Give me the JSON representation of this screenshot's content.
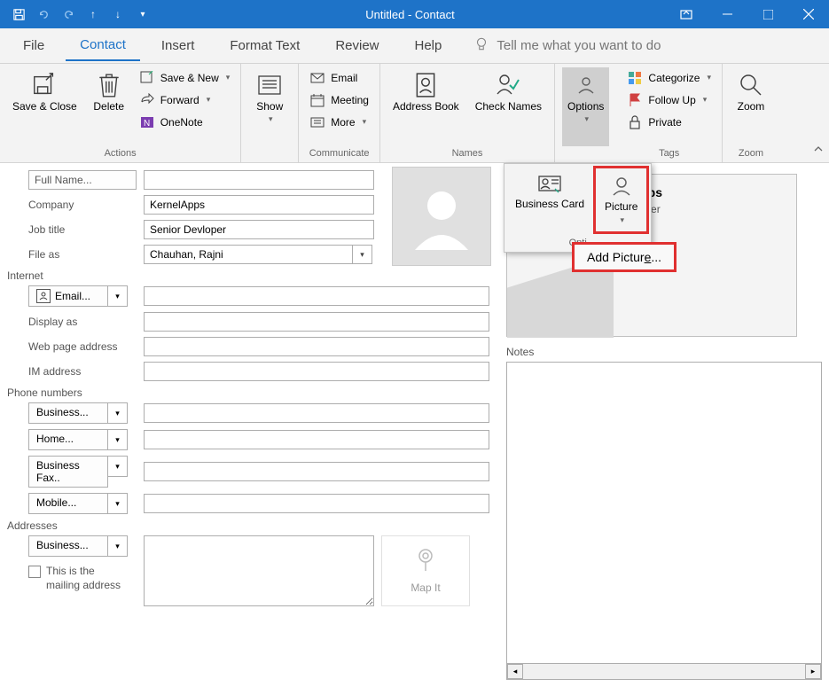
{
  "titlebar": {
    "title": "Untitled  -  Contact"
  },
  "tabs": {
    "file": "File",
    "contact": "Contact",
    "insert": "Insert",
    "format_text": "Format Text",
    "review": "Review",
    "help": "Help",
    "tell_me_placeholder": "Tell me what you want to do"
  },
  "ribbon": {
    "actions": {
      "save_close": "Save & Close",
      "delete": "Delete",
      "save_new": "Save & New",
      "forward": "Forward",
      "onenote": "OneNote",
      "group": "Actions"
    },
    "show": {
      "label": "Show",
      "group": "Show"
    },
    "communicate": {
      "email": "Email",
      "meeting": "Meeting",
      "more": "More",
      "group": "Communicate"
    },
    "names": {
      "address_book": "Address Book",
      "check_names": "Check Names",
      "group": "Names"
    },
    "options": {
      "label": "Options"
    },
    "tags": {
      "categorize": "Categorize",
      "follow_up": "Follow Up",
      "private": "Private",
      "group": "Tags"
    },
    "zoom": {
      "label": "Zoom",
      "group": "Zoom"
    }
  },
  "form": {
    "full_name_btn": "Full Name...",
    "company_label": "Company",
    "company_value": "KernelApps",
    "job_title_label": "Job title",
    "job_title_value": "Senior Devloper",
    "file_as_label": "File as",
    "file_as_value": "Chauhan, Rajni",
    "internet_hdr": "Internet",
    "email_btn": "Email...",
    "display_as_label": "Display as",
    "web_page_label": "Web page address",
    "im_label": "IM address",
    "phone_hdr": "Phone numbers",
    "phone1": "Business...",
    "phone2": "Home...",
    "phone3": "Business Fax..",
    "phone4": "Mobile...",
    "addresses_hdr": "Addresses",
    "addr_combo": "Business...",
    "mailing_cb": "This is the mailing address",
    "map_it": "Map It"
  },
  "bcard": {
    "name_partial": "Apps",
    "sub_partial": "vloper"
  },
  "notes": {
    "label": "Notes"
  },
  "options_popup": {
    "business_card": "Business Card",
    "picture": "Picture",
    "group": "Opti",
    "add_picture": "Add Picture..."
  }
}
